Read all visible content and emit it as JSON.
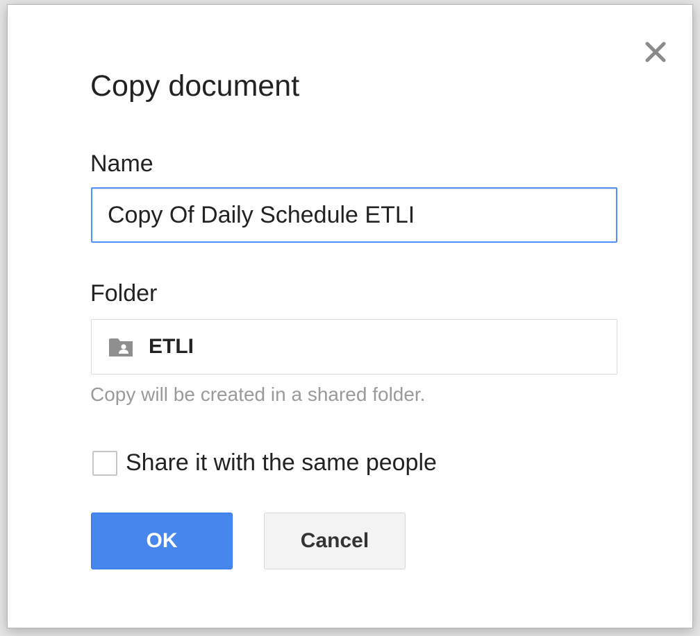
{
  "dialog": {
    "title": "Copy document",
    "name_label": "Name",
    "name_value": "Copy Of Daily Schedule ETLI",
    "folder_label": "Folder",
    "folder_name": "ETLI",
    "folder_icon": "shared-folder-icon",
    "hint": "Copy will be created in a shared folder.",
    "share_label": "Share it with the same people",
    "share_checked": false,
    "ok_label": "OK",
    "cancel_label": "Cancel",
    "close_icon": "close-icon"
  },
  "colors": {
    "primary_button": "#4787ed",
    "input_focus_border": "#4d90fe",
    "hint_text": "#9a9a9a"
  }
}
